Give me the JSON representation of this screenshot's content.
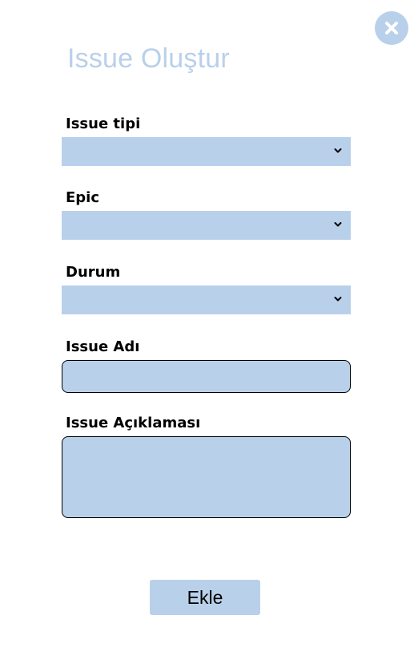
{
  "colors": {
    "accent": "#b9d0ea",
    "text": "#000000",
    "background": "#ffffff"
  },
  "header": {
    "title": "Issue Oluştur",
    "close_icon": "close-icon"
  },
  "form": {
    "issue_type": {
      "label": "Issue tipi",
      "value": ""
    },
    "epic": {
      "label": "Epic",
      "value": ""
    },
    "status": {
      "label": "Durum",
      "value": ""
    },
    "issue_name": {
      "label": "Issue Adı",
      "value": ""
    },
    "issue_description": {
      "label": "Issue Açıklaması",
      "value": ""
    },
    "submit_label": "Ekle"
  }
}
